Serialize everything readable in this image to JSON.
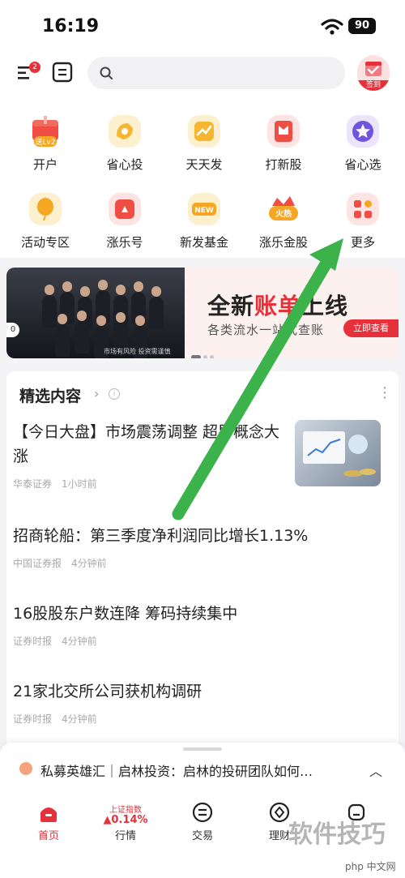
{
  "status": {
    "time": "16:19",
    "battery": "90"
  },
  "topbar": {
    "badge": "2",
    "search_placeholder": "",
    "signin_label": "签到"
  },
  "grid": [
    {
      "label": "开户",
      "icon": "open-account-icon",
      "tag": "送Lv2"
    },
    {
      "label": "省心投",
      "icon": "invest-icon"
    },
    {
      "label": "天天发",
      "icon": "growth-icon"
    },
    {
      "label": "打新股",
      "icon": "ipo-icon"
    },
    {
      "label": "省心选",
      "icon": "star-icon"
    },
    {
      "label": "活动专区",
      "icon": "balloon-icon"
    },
    {
      "label": "涨乐号",
      "icon": "zhangle-icon"
    },
    {
      "label": "新发基金",
      "icon": "new-fund-icon",
      "tag": "NEW"
    },
    {
      "label": "涨乐金股",
      "icon": "gold-stock-icon",
      "tag": "火热"
    },
    {
      "label": "更多",
      "icon": "more-grid-icon"
    }
  ],
  "banner": {
    "title_a": "全新",
    "title_b": "账单",
    "title_c": "上线",
    "subtitle": "各类流水一站式查账",
    "button": "立即查看",
    "note": "市场有风险  投资需谨慎"
  },
  "section": {
    "title": "精选内容"
  },
  "news": [
    {
      "title": "【今日大盘】市场震荡调整 超导概念大涨",
      "source": "华泰证券",
      "time": "1小时前"
    },
    {
      "title": "招商轮船：第三季度净利润同比增长1.13%",
      "source": "中国证券报",
      "time": "4分钟前"
    },
    {
      "title": "16股股东户数连降 筹码持续集中",
      "source": "证券时报",
      "time": "4分钟前"
    },
    {
      "title": "21家北交所公司获机构调研",
      "source": "证券时报",
      "time": "4分钟前"
    }
  ],
  "ticker": {
    "text": "私募英雄汇｜启林投资：启林的投研团队如何…"
  },
  "tabs": [
    {
      "label": "首页"
    },
    {
      "label": "行情",
      "index_name": "上证指数",
      "index_value": "▲0.14%"
    },
    {
      "label": "交易"
    },
    {
      "label": "理财"
    },
    {
      "label": ""
    }
  ],
  "watermark": {
    "main": "软件技巧",
    "sub": "php 中文网"
  },
  "colors": {
    "accent": "#e6313a",
    "arrow": "#3bb34a"
  }
}
